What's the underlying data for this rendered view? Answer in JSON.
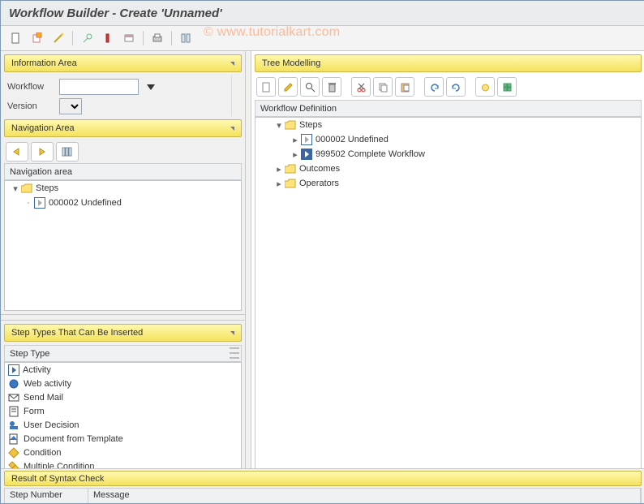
{
  "title": "Workflow Builder - Create 'Unnamed'",
  "watermark": "© www.tutorialkart.com",
  "info_area": {
    "header": "Information Area",
    "workflow_label": "Workflow",
    "workflow_value": "",
    "version_label": "Version",
    "version_value": ""
  },
  "nav_area": {
    "header": "Navigation Area",
    "sub_header": "Navigation area",
    "root": "Steps",
    "items": [
      {
        "id": "000002",
        "label": "000002 Undefined"
      }
    ]
  },
  "step_types": {
    "header": "Step Types That Can Be Inserted",
    "col_header": "Step Type",
    "items": [
      "Activity",
      "Web activity",
      "Send Mail",
      "Form",
      "User Decision",
      "Document from Template",
      "Condition",
      "Multiple Condition"
    ]
  },
  "tree_modelling": {
    "header": "Tree Modelling",
    "section": "Workflow Definition",
    "root": "Steps",
    "steps": [
      {
        "label": "000002 Undefined",
        "style": "gray"
      },
      {
        "label": "999502 Complete Workflow",
        "style": "blue"
      }
    ],
    "outcomes": "Outcomes",
    "operators": "Operators"
  },
  "syntax": {
    "header": "Result of Syntax Check",
    "col_step": "Step Number",
    "col_msg": "Message"
  }
}
